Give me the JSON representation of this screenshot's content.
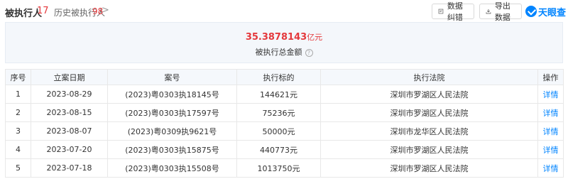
{
  "header": {
    "title": "被执行人",
    "title_count": "17",
    "history_label": "历史被执行人",
    "history_count": "98",
    "history_chevron": ">",
    "report_button": "数据纠错",
    "export_button": "导出数据",
    "logo_text": "天眼查"
  },
  "summary": {
    "amount": "35.3878143",
    "unit": "亿元",
    "label": "被执行总金额",
    "help_icon": "?"
  },
  "table": {
    "columns": [
      "序号",
      "立案日期",
      "案号",
      "执行标的",
      "执行法院",
      "操作"
    ],
    "rows": [
      {
        "index": "1",
        "date": "2023-08-29",
        "case_no": "(2023)粤0303执18145号",
        "amount": "144621元",
        "court": "深圳市罗湖区人民法院",
        "action": "详情"
      },
      {
        "index": "2",
        "date": "2023-08-15",
        "case_no": "(2023)粤0303执17597号",
        "amount": "75236元",
        "court": "深圳市罗湖区人民法院",
        "action": "详情"
      },
      {
        "index": "3",
        "date": "2023-08-07",
        "case_no": "(2023)粤0309执9621号",
        "amount": "50000元",
        "court": "深圳市龙华区人民法院",
        "action": "详情"
      },
      {
        "index": "4",
        "date": "2023-07-20",
        "case_no": "(2023)粤0303执15875号",
        "amount": "440773元",
        "court": "深圳市罗湖区人民法院",
        "action": "详情"
      },
      {
        "index": "5",
        "date": "2023-07-18",
        "case_no": "(2023)粤0303执15508号",
        "amount": "1013750元",
        "court": "深圳市罗湖区人民法院",
        "action": "详情"
      }
    ]
  },
  "colors": {
    "accent_red": "#e4393c",
    "link_blue": "#0084ff",
    "header_bg": "#f5f8fc"
  }
}
